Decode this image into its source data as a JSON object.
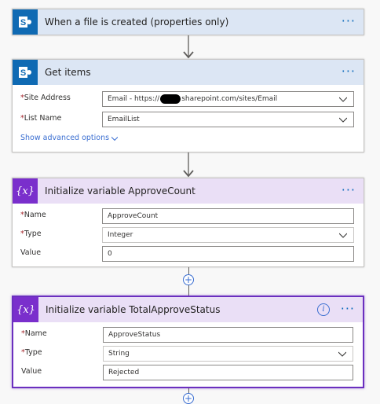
{
  "steps": [
    {
      "title": "When a file is created (properties only)"
    },
    {
      "title": "Get items",
      "fields": [
        {
          "label": "Site Address",
          "required": true,
          "value_prefix": "Email - https://",
          "value_suffix": "sharepoint.com/sites/Email",
          "type": "dropdown"
        },
        {
          "label": "List Name",
          "required": true,
          "value": "EmailList",
          "type": "dropdown"
        }
      ],
      "advanced": "Show advanced options"
    },
    {
      "title": "Initialize variable ApproveCount",
      "fields": [
        {
          "label": "Name",
          "required": true,
          "value": "ApproveCount"
        },
        {
          "label": "Type",
          "required": true,
          "value": "Integer"
        },
        {
          "label": "Value",
          "required": false,
          "value": "0"
        }
      ]
    },
    {
      "title": "Initialize variable TotalApproveStatus",
      "fields": [
        {
          "label": "Name",
          "required": true,
          "value": "ApproveStatus"
        },
        {
          "label": "Type",
          "required": true,
          "value": "String"
        },
        {
          "label": "Value",
          "required": false,
          "value": "Rejected"
        }
      ]
    }
  ],
  "ui": {
    "more_glyph": "···",
    "required_mark": "*",
    "plus_glyph": "+",
    "info_glyph": "i",
    "var_glyph": "{x}"
  },
  "colors": {
    "sharepoint_header": "#dce6f4",
    "variable_header": "#eadff6",
    "selected_border": "#6b2fbf",
    "link": "#3a6ed1"
  }
}
